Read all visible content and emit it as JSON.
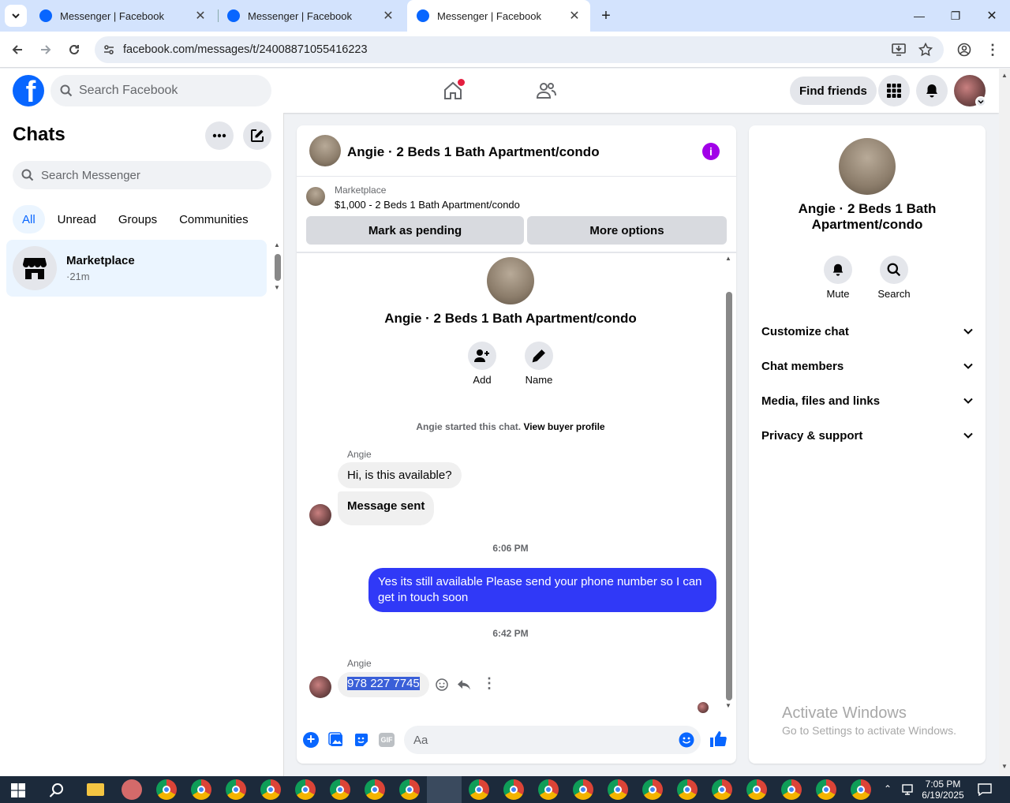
{
  "browser": {
    "tabs": [
      {
        "title": "Messenger | Facebook",
        "active": false
      },
      {
        "title": "Messenger | Facebook",
        "active": false
      },
      {
        "title": "Messenger | Facebook",
        "active": true
      }
    ],
    "url": "facebook.com/messages/t/24008871055416223"
  },
  "fb": {
    "search_placeholder": "Search Facebook",
    "find_friends": "Find friends"
  },
  "sidebar": {
    "title": "Chats",
    "search_placeholder": "Search Messenger",
    "filters": [
      "All",
      "Unread",
      "Groups",
      "Communities"
    ],
    "chats": [
      {
        "name": "Marketplace",
        "time": "·21m"
      }
    ]
  },
  "chat": {
    "title": "Angie · 2 Beds 1 Bath Apartment/condo",
    "listing": {
      "source": "Marketplace",
      "desc": "$1,000 - 2 Beds 1 Bath Apartment/condo",
      "pending_btn": "Mark as pending",
      "more_btn": "More options"
    },
    "profile_name": "Angie · 2 Beds 1 Bath Apartment/condo",
    "add_label": "Add",
    "name_label": "Name",
    "started_text": "Angie started this chat.",
    "buyer_link": "View buyer profile",
    "messages": [
      {
        "sender": "Angie",
        "text": "Hi, is this available?"
      },
      {
        "text": "Message sent"
      },
      {
        "time": "6:06 PM"
      },
      {
        "text": "Yes its still available Please send your phone number so I can get in touch soon"
      },
      {
        "time": "6:42 PM"
      },
      {
        "sender": "Angie",
        "text": "978 227 7745"
      }
    ],
    "composer_placeholder": "Aa"
  },
  "info": {
    "name": "Angie · 2 Beds 1 Bath Apartment/condo",
    "mute": "Mute",
    "search": "Search",
    "sections": [
      "Customize chat",
      "Chat members",
      "Media, files and links",
      "Privacy & support"
    ]
  },
  "watermark": {
    "title": "Activate Windows",
    "sub": "Go to Settings to activate Windows."
  },
  "taskbar": {
    "time": "7:05 PM",
    "date": "6/19/2025"
  },
  "colors": {
    "accent": "#0866ff",
    "my_bubble": "#3039f7",
    "info_icon": "#a100e8",
    "selection": "#3a5fd8"
  }
}
